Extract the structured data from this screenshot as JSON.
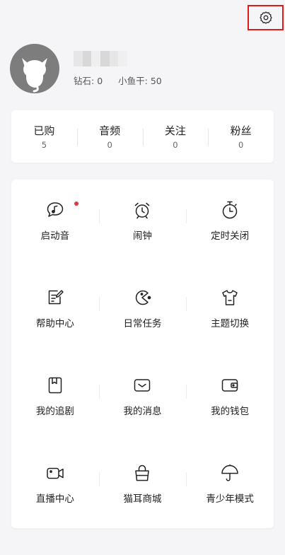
{
  "header": {
    "settings_icon": "gear-icon"
  },
  "profile": {
    "avatar_icon": "cat-avatar-icon",
    "diamond_label": "钻石:",
    "diamond_value": "0",
    "fish_label": "小鱼干:",
    "fish_value": "50"
  },
  "stats": [
    {
      "label": "已购",
      "value": "5"
    },
    {
      "label": "音频",
      "value": "0"
    },
    {
      "label": "关注",
      "value": "0"
    },
    {
      "label": "粉丝",
      "value": "0"
    }
  ],
  "menu": [
    {
      "label": "启动音",
      "icon": "speech-bubble-music-icon"
    },
    {
      "label": "闹钟",
      "icon": "alarm-clock-icon"
    },
    {
      "label": "定时关闭",
      "icon": "timer-icon"
    },
    {
      "label": "帮助中心",
      "icon": "help-document-icon"
    },
    {
      "label": "日常任务",
      "icon": "pacman-icon"
    },
    {
      "label": "主题切换",
      "icon": "tshirt-icon"
    },
    {
      "label": "我的追剧",
      "icon": "bookmark-icon"
    },
    {
      "label": "我的消息",
      "icon": "envelope-icon"
    },
    {
      "label": "我的钱包",
      "icon": "wallet-icon"
    },
    {
      "label": "直播中心",
      "icon": "video-camera-icon"
    },
    {
      "label": "猫耳商城",
      "icon": "shopping-bag-icon"
    },
    {
      "label": "青少年模式",
      "icon": "umbrella-icon"
    }
  ],
  "colors": {
    "accent_red": "#e0191a",
    "badge_dot": "#e2383a",
    "background": "#f5f5f7"
  }
}
